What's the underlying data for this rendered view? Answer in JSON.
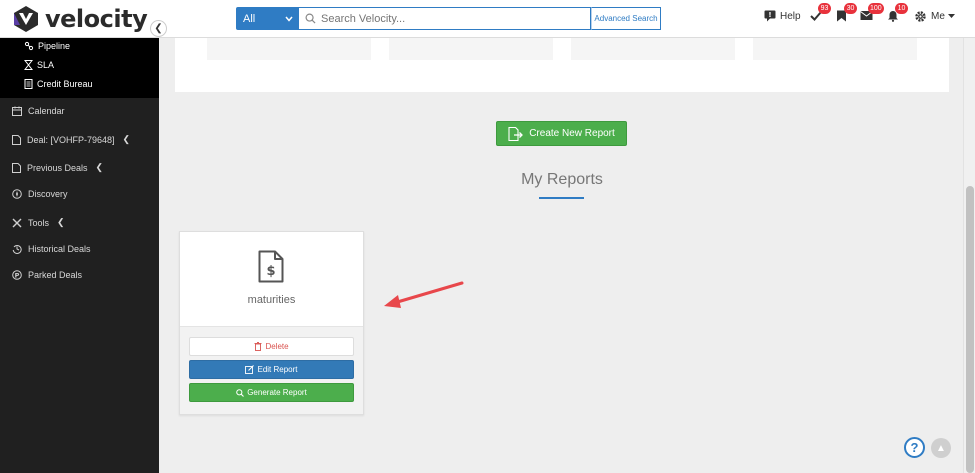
{
  "app": {
    "name": "velocity"
  },
  "search": {
    "scope": "All",
    "placeholder": "Search Velocity...",
    "advanced_label": "Advanced Search"
  },
  "top_right": {
    "help_label": "Help",
    "tasks_count": "93",
    "bookmarks_count": "30",
    "messages_count": "100",
    "alerts_count": "10",
    "user_label": "Me"
  },
  "sidebar": {
    "sub_items": [
      {
        "label": "Pipeline",
        "icon": "pipeline-icon"
      },
      {
        "label": "SLA",
        "icon": "hourglass-icon"
      },
      {
        "label": "Credit Bureau",
        "icon": "document-icon"
      }
    ],
    "items": [
      {
        "label": "Calendar",
        "icon": "calendar-icon",
        "expandable": false
      },
      {
        "label": "Deal: [VOHFP-79648]",
        "icon": "file-icon",
        "expandable": true
      },
      {
        "label": "Previous Deals",
        "icon": "file-icon",
        "expandable": true
      },
      {
        "label": "Discovery",
        "icon": "compass-icon",
        "expandable": false
      },
      {
        "label": "Tools",
        "icon": "tools-icon",
        "expandable": true
      },
      {
        "label": "Historical Deals",
        "icon": "history-icon",
        "expandable": false
      },
      {
        "label": "Parked Deals",
        "icon": "parking-icon",
        "expandable": false
      }
    ]
  },
  "main": {
    "create_button_label": "Create New Report",
    "section_title": "My Reports",
    "reports": [
      {
        "name": "maturities",
        "icon": "invoice-dollar-icon",
        "delete_label": "Delete",
        "edit_label": "Edit Report",
        "generate_label": "Generate Report"
      }
    ]
  },
  "colors": {
    "brand_blue": "#2f7cc4",
    "success_green": "#4cae4c",
    "danger_red": "#d9534f",
    "sidebar_bg": "#202020",
    "badge_red": "#e8323c",
    "annotation_arrow": "#e8474b"
  }
}
